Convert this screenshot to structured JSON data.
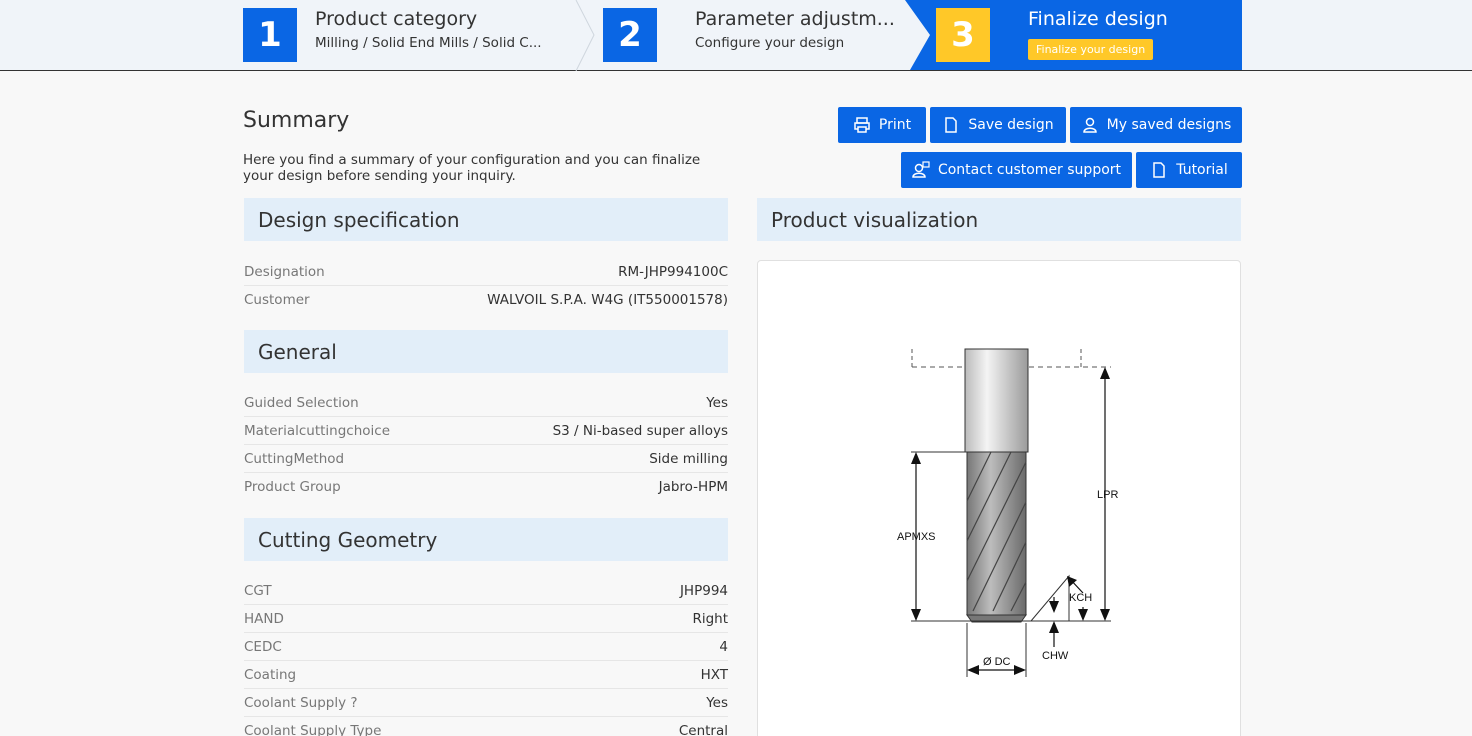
{
  "stepper": {
    "steps": [
      {
        "number": "1",
        "title": "Product category",
        "subtitle": "Milling / Solid End Mills / Solid C..."
      },
      {
        "number": "2",
        "title": "Parameter adjustm...",
        "subtitle": "Configure your design"
      },
      {
        "number": "3",
        "title": "Finalize design",
        "badge": "Finalize your design"
      }
    ]
  },
  "summary": {
    "title": "Summary",
    "description": "Here you find a summary of your configuration and you can finalize your design before sending your inquiry."
  },
  "buttons": {
    "print": "Print",
    "save": "Save design",
    "my_saved": "My saved designs",
    "contact": "Contact customer support",
    "tutorial": "Tutorial"
  },
  "sections": {
    "design_spec": {
      "title": "Design specification",
      "rows": [
        {
          "label": "Designation",
          "value": "RM-JHP994100C"
        },
        {
          "label": "Customer",
          "value": "WALVOIL S.P.A. W4G (IT550001578)"
        }
      ]
    },
    "general": {
      "title": "General",
      "rows": [
        {
          "label": "Guided Selection",
          "value": "Yes"
        },
        {
          "label": "Materialcuttingchoice",
          "value": "S3 / Ni-based super alloys"
        },
        {
          "label": "CuttingMethod",
          "value": "Side milling"
        },
        {
          "label": "Product Group",
          "value": "Jabro-HPM"
        }
      ]
    },
    "cutting_geometry": {
      "title": "Cutting Geometry",
      "rows": [
        {
          "label": "CGT",
          "value": "JHP994"
        },
        {
          "label": "HAND",
          "value": "Right"
        },
        {
          "label": "CEDC",
          "value": "4"
        },
        {
          "label": "Coating",
          "value": "HXT"
        },
        {
          "label": "Coolant Supply ?",
          "value": "Yes"
        },
        {
          "label": "Coolant Supply Type",
          "value": "Central"
        }
      ]
    },
    "visualization": {
      "title": "Product visualization",
      "labels": {
        "lpr": "LPR",
        "apmxs": "APMXS",
        "kch": "KCH",
        "chw": "CHW",
        "dc": "Ø DC"
      }
    }
  },
  "colors": {
    "primary": "#0a66e4",
    "accent": "#ffc828",
    "section_bg": "#e2eef9"
  }
}
